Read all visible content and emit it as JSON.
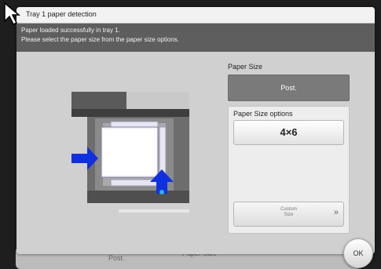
{
  "background": {
    "left_text": "Post.",
    "right_text": "Paper Size"
  },
  "dialog": {
    "title": "Tray 1 paper detection",
    "message_line1": "Paper loaded successfully in tray 1.",
    "message_line2": "Please select the paper size from the paper size options."
  },
  "paper_size": {
    "label": "Paper Size",
    "value": "Post."
  },
  "options": {
    "label": "Paper Size options",
    "size_button": "4×6",
    "custom_line1": "Custom",
    "custom_line2": "Size",
    "custom_arrow": "»"
  },
  "ok_button": {
    "label": "OK"
  },
  "colors": {
    "arrow_blue": "#1030e0",
    "message_bg": "#5e5e5e",
    "value_bg": "#7a7a7a"
  }
}
